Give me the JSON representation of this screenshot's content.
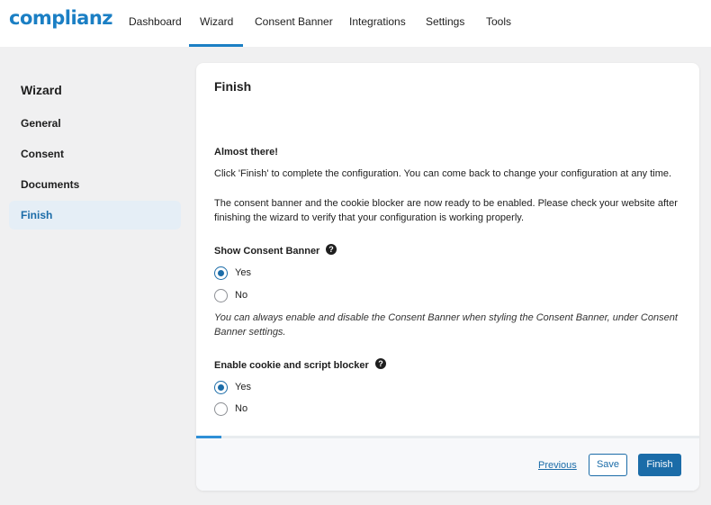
{
  "app": {
    "logo": "complianz",
    "brand_color": "#1b7fc4"
  },
  "nav": {
    "items": [
      "Dashboard",
      "Wizard",
      "Consent Banner",
      "Integrations",
      "Settings",
      "Tools"
    ],
    "active": "Wizard"
  },
  "sidebar": {
    "title": "Wizard",
    "items": [
      "General",
      "Consent",
      "Documents",
      "Finish"
    ],
    "active": "Finish"
  },
  "card": {
    "title": "Finish",
    "heading": "Almost there!",
    "para1": "Click 'Finish' to complete the configuration. You can come back to change your configuration at any time.",
    "para2": "The consent banner and the cookie blocker are now ready to be enabled. Please check your website after finishing the wizard to verify that your configuration is working properly.",
    "show_banner": {
      "label": "Show Consent Banner",
      "options": [
        "Yes",
        "No"
      ],
      "selected": "Yes",
      "note": "You can always enable and disable the Consent Banner when styling the Consent Banner, under Consent Banner settings."
    },
    "blocker": {
      "label": "Enable cookie and script blocker",
      "options": [
        "Yes",
        "No"
      ],
      "selected": "Yes"
    },
    "help_glyph": "?",
    "progress_percent": 5
  },
  "footer": {
    "previous": "Previous",
    "save": "Save",
    "finish": "Finish"
  }
}
